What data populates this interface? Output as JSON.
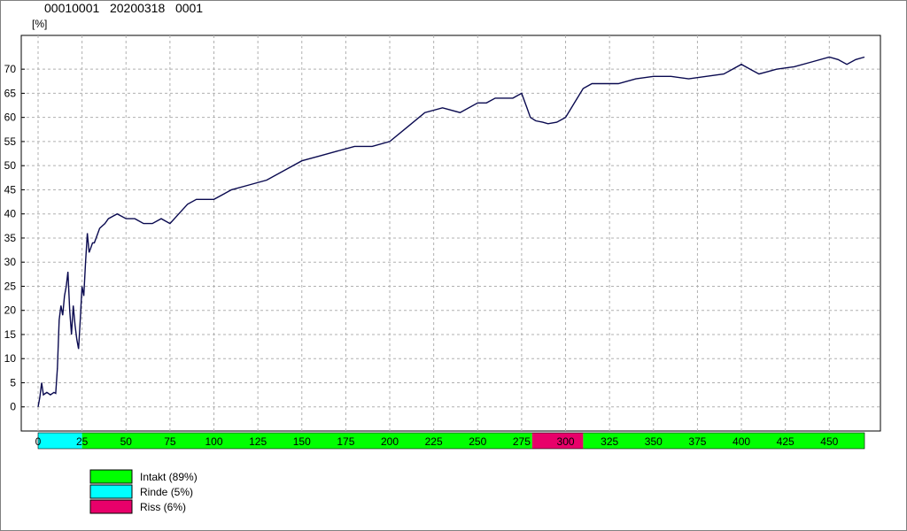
{
  "header": {
    "id": "00010001",
    "date": "20200318",
    "seq": "0001"
  },
  "chart_data": {
    "type": "line",
    "ylabel": "[%]",
    "xlim": [
      0,
      470
    ],
    "ylim": [
      -5,
      77
    ],
    "yticks": [
      0,
      5,
      10,
      15,
      20,
      25,
      30,
      35,
      40,
      45,
      50,
      55,
      60,
      65,
      70
    ],
    "xticks": [
      0,
      25,
      50,
      75,
      100,
      125,
      150,
      175,
      200,
      225,
      250,
      275,
      300,
      325,
      350,
      375,
      400,
      425,
      450
    ],
    "grid": true,
    "series": [
      {
        "x": [
          0,
          1,
          2,
          3,
          5,
          7,
          9,
          10,
          11,
          12,
          13,
          14,
          15,
          16,
          17,
          18,
          19,
          20,
          21,
          22,
          23,
          24,
          25,
          26,
          27,
          28,
          29,
          30,
          31,
          32,
          33,
          35,
          38,
          40,
          45,
          50,
          55,
          60,
          65,
          70,
          75,
          80,
          85,
          90,
          95,
          100,
          110,
          120,
          130,
          140,
          150,
          160,
          170,
          180,
          190,
          200,
          210,
          220,
          230,
          240,
          250,
          255,
          260,
          265,
          270,
          275,
          278,
          280,
          283,
          287,
          290,
          295,
          300,
          305,
          310,
          315,
          320,
          325,
          330,
          340,
          350,
          360,
          370,
          380,
          390,
          400,
          405,
          410,
          415,
          420,
          430,
          440,
          450,
          455,
          460,
          465,
          470
        ],
        "y": [
          0,
          2,
          5,
          2.5,
          3,
          2.5,
          3,
          2.8,
          8,
          18,
          21,
          19,
          23,
          25,
          28,
          20,
          15,
          21,
          17,
          14,
          12,
          18,
          25,
          23,
          30,
          36,
          32,
          33,
          34,
          34,
          35,
          37,
          38,
          39,
          40,
          39,
          39,
          38,
          38,
          39,
          38,
          40,
          42,
          43,
          43,
          43,
          45,
          46,
          47,
          49,
          51,
          52,
          53,
          54,
          54,
          55,
          58,
          61,
          62,
          61,
          63,
          63,
          64,
          64,
          64,
          65,
          62,
          60,
          59.3,
          59,
          58.7,
          59,
          60,
          63,
          66,
          67,
          67,
          67,
          67,
          68,
          68.5,
          68.5,
          68,
          68.5,
          69,
          71,
          70,
          69,
          69.5,
          70,
          70.5,
          71.5,
          72.5,
          72,
          71,
          72,
          72.5
        ]
      }
    ],
    "segments": [
      {
        "start": 0,
        "end": 25,
        "color": "#00ffff"
      },
      {
        "start": 25,
        "end": 281,
        "color": "#00ff00"
      },
      {
        "start": 281,
        "end": 310,
        "color": "#e8006a"
      },
      {
        "start": 310,
        "end": 470,
        "color": "#00ff00"
      }
    ],
    "legend": [
      {
        "label": "Intakt (89%)",
        "color": "#00ff00"
      },
      {
        "label": "Rinde (5%)",
        "color": "#00ffff"
      },
      {
        "label": "Riss (6%)",
        "color": "#e8006a"
      }
    ],
    "line_color": "#0a0a50"
  }
}
